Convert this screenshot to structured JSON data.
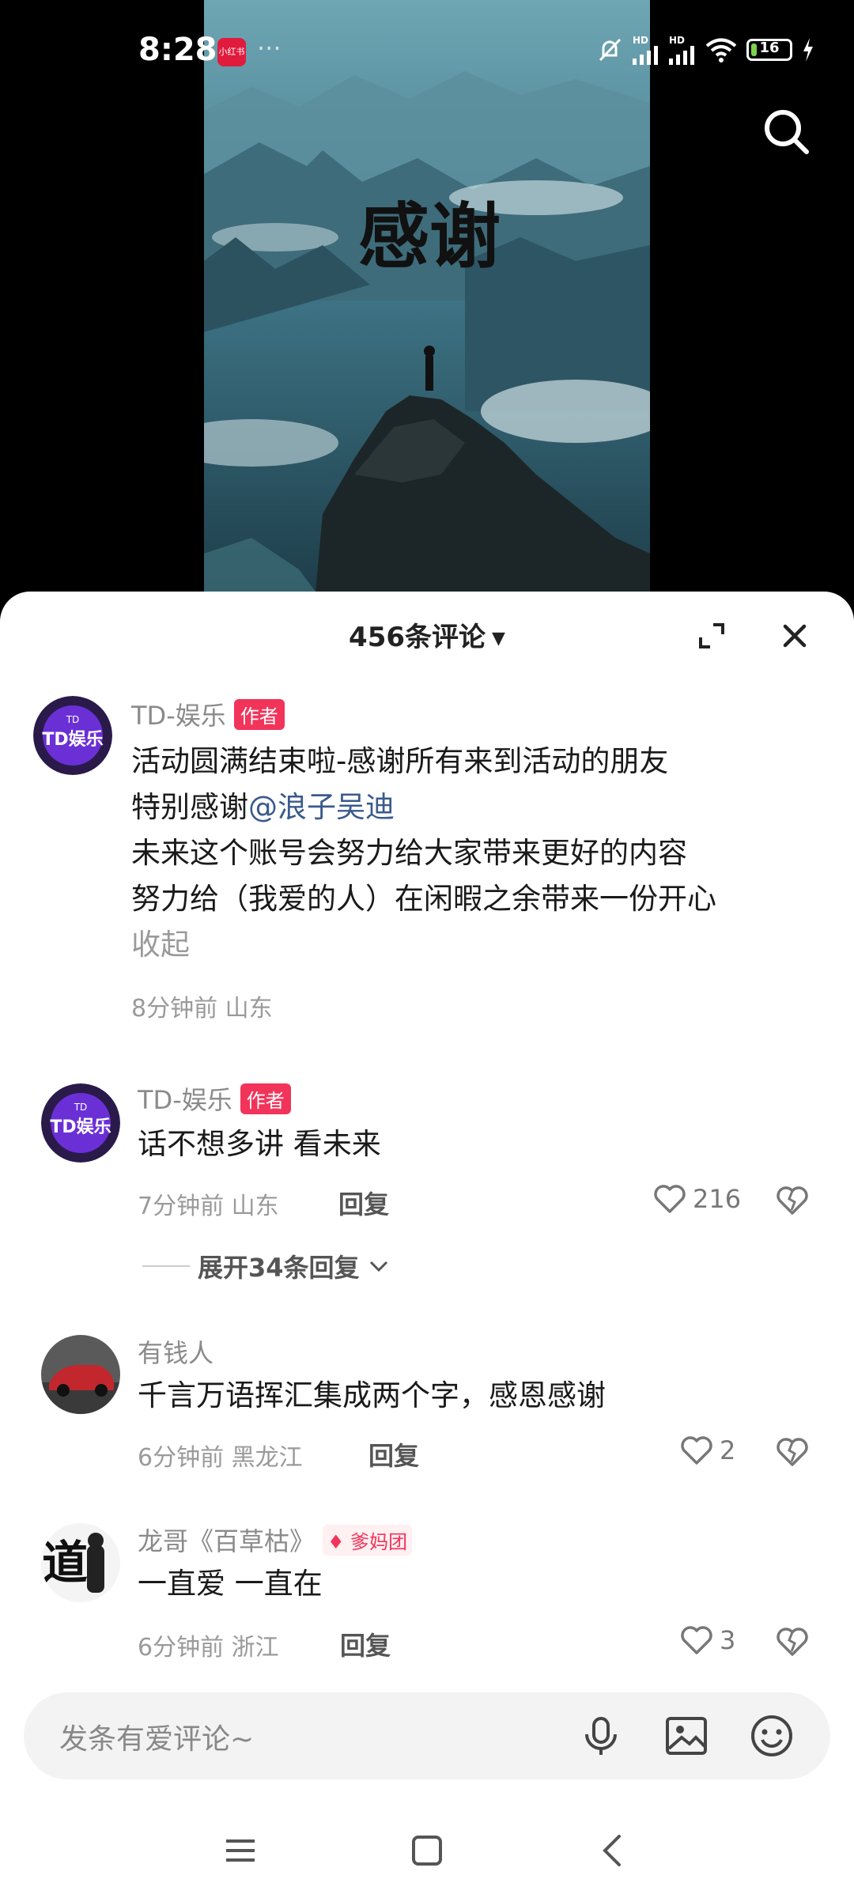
{
  "status": {
    "time": "8:28",
    "app_badge": "小红书",
    "dots": "···",
    "signal_labels": [
      "HD",
      "HD"
    ],
    "battery": "16",
    "battery_level": 0.16
  },
  "video": {
    "overlay_text": "感谢"
  },
  "comments_panel": {
    "title": "456条评论",
    "input_placeholder": "发条有爱评论~"
  },
  "comments": [
    {
      "user": "TD-娱乐",
      "badge": "作者",
      "lines": [
        "活动圆满结束啦-感谢所有来到活动的朋友",
        "特别感谢",
        "@浪子吴迪",
        "未来这个账号会努力给大家带来更好的内容",
        "努力给（我爱的人）在闲暇之余带来一份开心"
      ],
      "collapse": "收起",
      "time": "8分钟前",
      "location": "山东"
    },
    {
      "user": "TD-娱乐",
      "badge": "作者",
      "text": "话不想多讲 看未来",
      "time": "7分钟前",
      "location": "山东",
      "reply": "回复",
      "likes": "216",
      "expand": "展开34条回复"
    },
    {
      "user": "有钱人",
      "text": "千言万语挥汇集成两个字，感恩感谢",
      "time": "6分钟前",
      "location": "黑龙江",
      "reply": "回复",
      "likes": "2"
    },
    {
      "user": "龙哥《百草枯》",
      "badge": "爹妈团",
      "text": "一直爱 一直在",
      "time": "6分钟前",
      "location": "浙江",
      "reply": "回复",
      "likes": "3"
    }
  ],
  "avatar_text": {
    "td_top": "TD",
    "td_main": "TD娱乐",
    "dao": "道"
  },
  "colors": {
    "accent": "#f2345a",
    "mention": "#3a5a8c",
    "battery": "#7cd34a"
  }
}
